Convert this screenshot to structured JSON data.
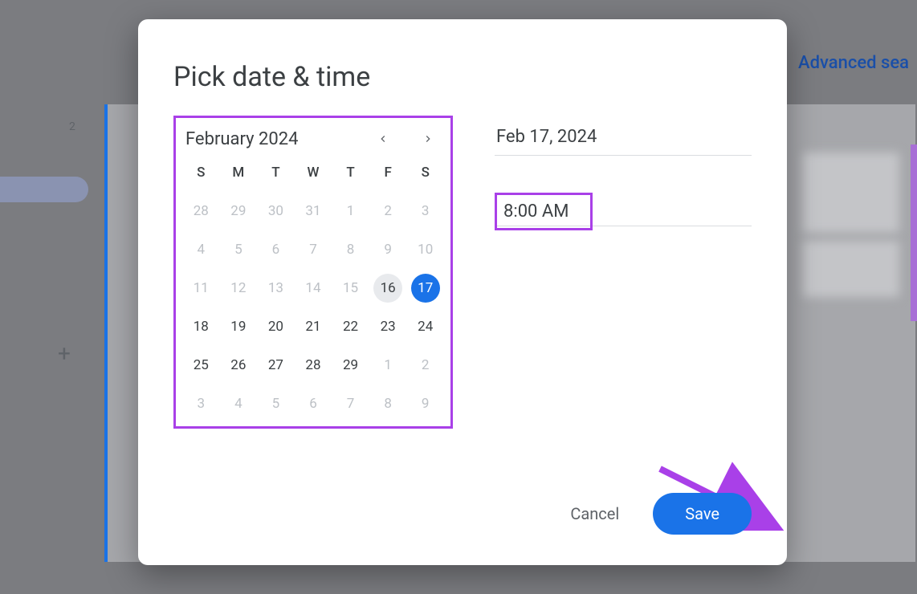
{
  "background": {
    "advanced_search_label": "Advanced sea",
    "sidebar_number": "2"
  },
  "modal": {
    "title": "Pick date & time",
    "calendar": {
      "month_year": "February 2024",
      "day_headers": [
        "S",
        "M",
        "T",
        "W",
        "T",
        "F",
        "S"
      ],
      "weeks": [
        [
          {
            "n": "28",
            "muted": true
          },
          {
            "n": "29",
            "muted": true
          },
          {
            "n": "30",
            "muted": true
          },
          {
            "n": "31",
            "muted": true
          },
          {
            "n": "1",
            "muted": true
          },
          {
            "n": "2",
            "muted": true
          },
          {
            "n": "3",
            "muted": true
          }
        ],
        [
          {
            "n": "4",
            "muted": true
          },
          {
            "n": "5",
            "muted": true
          },
          {
            "n": "6",
            "muted": true
          },
          {
            "n": "7",
            "muted": true
          },
          {
            "n": "8",
            "muted": true
          },
          {
            "n": "9",
            "muted": true
          },
          {
            "n": "10",
            "muted": true
          }
        ],
        [
          {
            "n": "11",
            "muted": true
          },
          {
            "n": "12",
            "muted": true
          },
          {
            "n": "13",
            "muted": true
          },
          {
            "n": "14",
            "muted": true
          },
          {
            "n": "15",
            "muted": true
          },
          {
            "n": "16",
            "today": true
          },
          {
            "n": "17",
            "selected": true
          }
        ],
        [
          {
            "n": "18"
          },
          {
            "n": "19"
          },
          {
            "n": "20"
          },
          {
            "n": "21"
          },
          {
            "n": "22"
          },
          {
            "n": "23"
          },
          {
            "n": "24"
          }
        ],
        [
          {
            "n": "25"
          },
          {
            "n": "26"
          },
          {
            "n": "27"
          },
          {
            "n": "28"
          },
          {
            "n": "29"
          },
          {
            "n": "1",
            "muted": true
          },
          {
            "n": "2",
            "muted": true
          }
        ],
        [
          {
            "n": "3",
            "muted": true
          },
          {
            "n": "4",
            "muted": true
          },
          {
            "n": "5",
            "muted": true
          },
          {
            "n": "6",
            "muted": true
          },
          {
            "n": "7",
            "muted": true
          },
          {
            "n": "8",
            "muted": true
          },
          {
            "n": "9",
            "muted": true
          }
        ]
      ]
    },
    "date_value": "Feb 17, 2024",
    "time_value": "8:00 AM",
    "cancel_label": "Cancel",
    "save_label": "Save"
  },
  "annotation_colors": {
    "highlight": "#a940e8",
    "arrow": "#a940e8"
  }
}
